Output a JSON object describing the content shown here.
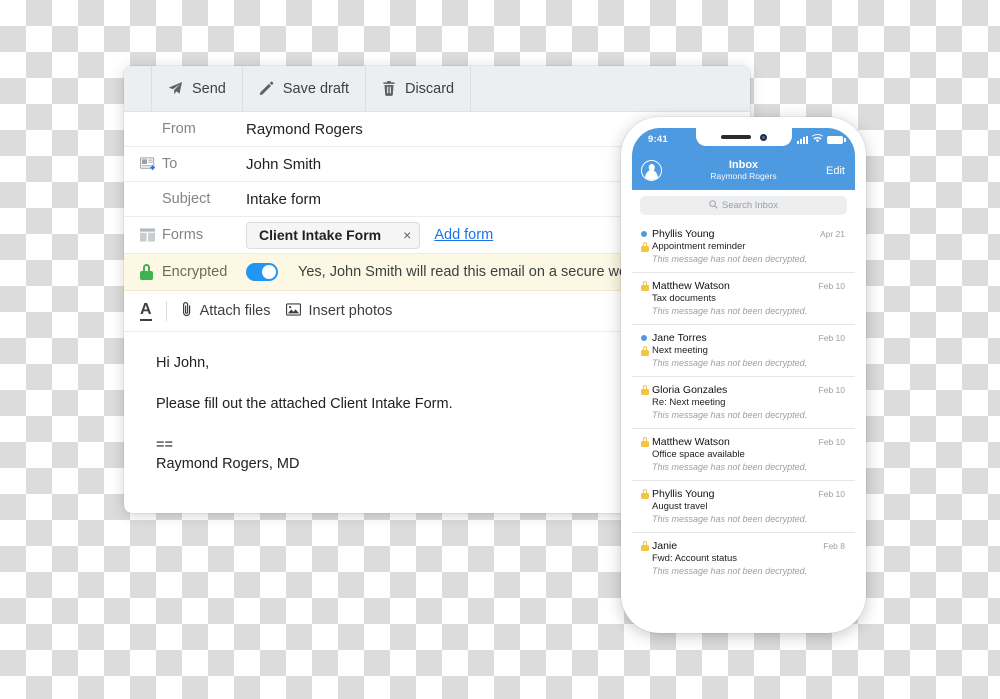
{
  "compose": {
    "toolbar": {
      "send_label": "Send",
      "save_draft_label": "Save draft",
      "discard_label": "Discard",
      "send_icon": "paper-plane-icon",
      "save_draft_icon": "pencil-icon",
      "discard_icon": "trash-icon"
    },
    "fields": {
      "from_label": "From",
      "from_value": "Raymond Rogers",
      "to_label": "To",
      "to_value": "John Smith",
      "to_icon": "add-contact-icon",
      "subject_label": "Subject",
      "subject_value": "Intake form",
      "forms_label": "Forms",
      "forms_icon": "form-icon",
      "form_chip_label": "Client Intake Form",
      "form_chip_remove": "×",
      "add_form_label": "Add form"
    },
    "encrypted": {
      "label": "Encrypted",
      "icon": "green-lock-icon",
      "toggle_on": true,
      "message": "Yes, John Smith will read this email on a secure web page.",
      "background": "#fcf8e3",
      "toggle_color": "#2196f3",
      "lock_color": "#3fb24f"
    },
    "attach_bar": {
      "format_text_label": "A",
      "attach_files_label": "Attach files",
      "attach_files_icon": "paperclip-icon",
      "insert_photos_label": "Insert photos",
      "insert_photos_icon": "image-icon"
    },
    "body": {
      "greeting": "Hi John,",
      "paragraph": "Please fill out the attached Client Intake Form.",
      "separator": "==",
      "signature": "Raymond Rogers, MD"
    }
  },
  "phone": {
    "status": {
      "time": "9:41",
      "signal_icon": "signal-bars-icon",
      "wifi_icon": "wifi-icon",
      "battery_icon": "battery-icon"
    },
    "nav": {
      "avatar_icon": "account-avatar-icon",
      "title": "Inbox",
      "subtitle": "Raymond Rogers",
      "edit_label": "Edit"
    },
    "search": {
      "placeholder": "Search Inbox",
      "icon": "search-icon"
    },
    "accent_color": "#4d9ae0",
    "lock_color": "#f5c445",
    "unread_dot_color": "#4d9ae0",
    "messages": [
      {
        "sender": "Phyllis Young",
        "subject": "Appointment reminder",
        "snippet": "This message has not been decrypted.",
        "date": "Apr 21",
        "unread": true,
        "lock_on_subject": true
      },
      {
        "sender": "Matthew Watson",
        "subject": "Tax documents",
        "snippet": "This message has not been decrypted.",
        "date": "Feb 10",
        "unread": false,
        "lock_on_subject": false
      },
      {
        "sender": "Jane Torres",
        "subject": "Next meeting",
        "snippet": "This message has not been decrypted.",
        "date": "Feb 10",
        "unread": true,
        "lock_on_subject": true
      },
      {
        "sender": "Gloria Gonzales",
        "subject": "Re: Next meeting",
        "snippet": "This message has not been decrypted.",
        "date": "Feb 10",
        "unread": false,
        "lock_on_subject": false
      },
      {
        "sender": "Matthew Watson",
        "subject": "Office space available",
        "snippet": "This message has not been decrypted.",
        "date": "Feb 10",
        "unread": false,
        "lock_on_subject": false
      },
      {
        "sender": "Phyllis Young",
        "subject": "August travel",
        "snippet": "This message has not been decrypted.",
        "date": "Feb 10",
        "unread": false,
        "lock_on_subject": false
      },
      {
        "sender": "Janie",
        "subject": "Fwd: Account status",
        "snippet": "This message has not been decrypted.",
        "date": "Feb 8",
        "unread": false,
        "lock_on_subject": false
      }
    ]
  }
}
